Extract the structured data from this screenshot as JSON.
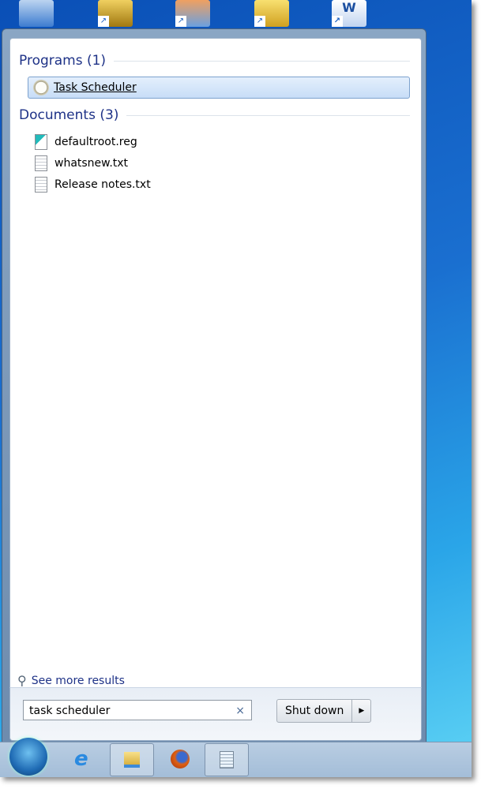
{
  "desktop": {
    "icons": [
      "computer-icon",
      "lock-shortcut-icon",
      "image-tool-shortcut-icon",
      "uac-shortcut-icon",
      "word-shortcut-icon"
    ]
  },
  "start_menu": {
    "programs_header": "Programs (1)",
    "programs": [
      {
        "label": "Task Scheduler",
        "icon": "clock-icon"
      }
    ],
    "documents_header": "Documents (3)",
    "documents": [
      {
        "label": "defaultroot.reg",
        "icon": "registry-file-icon"
      },
      {
        "label": "whatsnew.txt",
        "icon": "text-file-icon"
      },
      {
        "label": "Release notes.txt",
        "icon": "text-file-icon"
      }
    ],
    "see_more": "See more results",
    "search_value": "task scheduler",
    "clear_glyph": "×",
    "shutdown_label": "Shut down",
    "arrow_glyph": "▶"
  },
  "taskbar": {
    "items": [
      "start-orb",
      "internet-explorer-icon",
      "file-explorer-icon",
      "firefox-icon",
      "notepad-icon"
    ]
  }
}
